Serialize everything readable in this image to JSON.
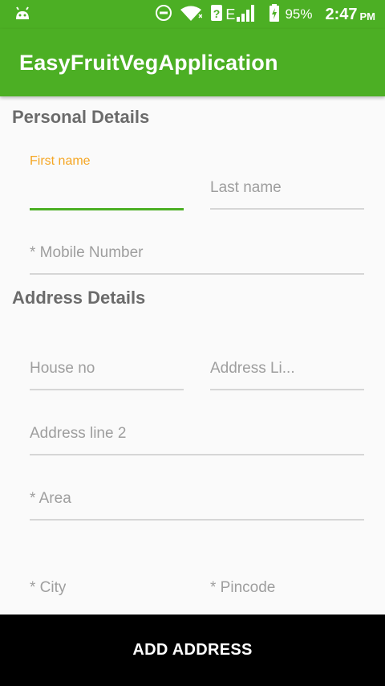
{
  "status_bar": {
    "battery_percent": "95%",
    "time": "2:47",
    "ampm": "PM",
    "network_label": "E",
    "icons": [
      "android-icon",
      "do-not-disturb-icon",
      "wifi-icon",
      "sim-unknown-icon",
      "signal-icon",
      "battery-charging-icon"
    ]
  },
  "app_bar": {
    "title": "EasyFruitVegApplication"
  },
  "personal": {
    "title": "Personal Details",
    "first_name_label": "First name",
    "last_name_placeholder": "Last name",
    "mobile_placeholder": "* Mobile Number"
  },
  "address": {
    "title": "Address Details",
    "house_placeholder": "House no",
    "line1_placeholder": "Address Li...",
    "line2_placeholder": "Address line 2",
    "area_placeholder": "* Area",
    "city_placeholder": "* City",
    "pincode_placeholder": "* Pincode"
  },
  "actions": {
    "add_address_label": "ADD ADDRESS"
  },
  "colors": {
    "primary": "#4caf24",
    "accent": "#f5a623",
    "button_bg": "#000000"
  }
}
